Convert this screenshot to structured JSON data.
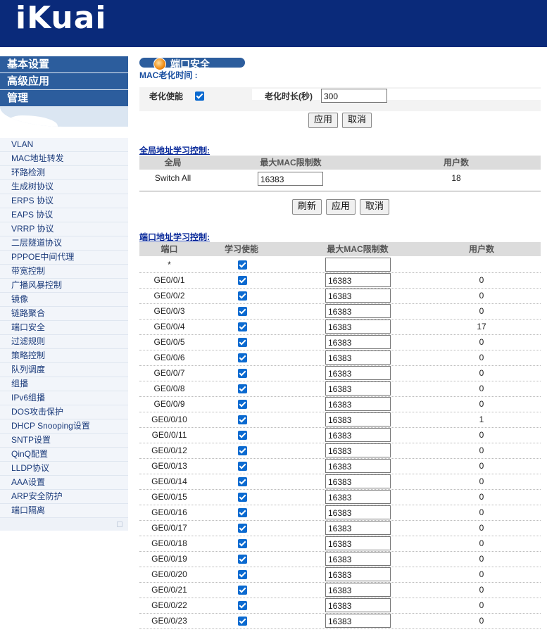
{
  "header": {
    "logo": "iKuai"
  },
  "sidebar": {
    "sections": [
      "基本设置",
      "高级应用",
      "管理"
    ],
    "items": [
      "VLAN",
      "MAC地址转发",
      "环路检测",
      "生成树协议",
      "ERPS 协议",
      "EAPS 协议",
      "VRRP 协议",
      "二层隧道协议",
      "PPPOE中间代理",
      "带宽控制",
      "广播风暴控制",
      "镜像",
      "链路聚合",
      "端口安全",
      "过滤规则",
      "策略控制",
      "队列调度",
      "组播",
      "IPv6组播",
      "DOS攻击保护",
      "DHCP Snooping设置",
      "SNTP设置",
      "QinQ配置",
      "LLDP协议",
      "AAA设置",
      "ARP安全防护",
      "端口隔离"
    ]
  },
  "page": {
    "title": "端口安全",
    "aging_section": "MAC老化时间 :",
    "aging_enable_label": "老化使能",
    "aging_enabled": true,
    "aging_time_label": "老化时长(秒)",
    "aging_time_value": "300",
    "apply_label": "应用",
    "cancel_label": "取消",
    "refresh_label": "刷新"
  },
  "global_learning": {
    "title": "全局地址学习控制:",
    "headers": [
      "全局",
      "最大MAC限制数",
      "用户数"
    ],
    "row": {
      "name": "Switch All",
      "max_mac": "16383",
      "users": "18"
    }
  },
  "port_learning": {
    "title": "端口地址学习控制:",
    "headers": [
      "端口",
      "学习使能",
      "最大MAC限制数",
      "用户数"
    ],
    "rows": [
      {
        "port": "*",
        "enabled": true,
        "max_mac": "",
        "users": ""
      },
      {
        "port": "GE0/0/1",
        "enabled": true,
        "max_mac": "16383",
        "users": "0"
      },
      {
        "port": "GE0/0/2",
        "enabled": true,
        "max_mac": "16383",
        "users": "0"
      },
      {
        "port": "GE0/0/3",
        "enabled": true,
        "max_mac": "16383",
        "users": "0"
      },
      {
        "port": "GE0/0/4",
        "enabled": true,
        "max_mac": "16383",
        "users": "17"
      },
      {
        "port": "GE0/0/5",
        "enabled": true,
        "max_mac": "16383",
        "users": "0"
      },
      {
        "port": "GE0/0/6",
        "enabled": true,
        "max_mac": "16383",
        "users": "0"
      },
      {
        "port": "GE0/0/7",
        "enabled": true,
        "max_mac": "16383",
        "users": "0"
      },
      {
        "port": "GE0/0/8",
        "enabled": true,
        "max_mac": "16383",
        "users": "0"
      },
      {
        "port": "GE0/0/9",
        "enabled": true,
        "max_mac": "16383",
        "users": "0"
      },
      {
        "port": "GE0/0/10",
        "enabled": true,
        "max_mac": "16383",
        "users": "1"
      },
      {
        "port": "GE0/0/11",
        "enabled": true,
        "max_mac": "16383",
        "users": "0"
      },
      {
        "port": "GE0/0/12",
        "enabled": true,
        "max_mac": "16383",
        "users": "0"
      },
      {
        "port": "GE0/0/13",
        "enabled": true,
        "max_mac": "16383",
        "users": "0"
      },
      {
        "port": "GE0/0/14",
        "enabled": true,
        "max_mac": "16383",
        "users": "0"
      },
      {
        "port": "GE0/0/15",
        "enabled": true,
        "max_mac": "16383",
        "users": "0"
      },
      {
        "port": "GE0/0/16",
        "enabled": true,
        "max_mac": "16383",
        "users": "0"
      },
      {
        "port": "GE0/0/17",
        "enabled": true,
        "max_mac": "16383",
        "users": "0"
      },
      {
        "port": "GE0/0/18",
        "enabled": true,
        "max_mac": "16383",
        "users": "0"
      },
      {
        "port": "GE0/0/19",
        "enabled": true,
        "max_mac": "16383",
        "users": "0"
      },
      {
        "port": "GE0/0/20",
        "enabled": true,
        "max_mac": "16383",
        "users": "0"
      },
      {
        "port": "GE0/0/21",
        "enabled": true,
        "max_mac": "16383",
        "users": "0"
      },
      {
        "port": "GE0/0/22",
        "enabled": true,
        "max_mac": "16383",
        "users": "0"
      },
      {
        "port": "GE0/0/23",
        "enabled": true,
        "max_mac": "16383",
        "users": "0"
      }
    ]
  },
  "colors": {
    "header_bg": "#0a2a7a",
    "sidebar_head": "#2c5d9d",
    "checkbox": "#0b6ad0",
    "link": "#0a2a9a"
  }
}
